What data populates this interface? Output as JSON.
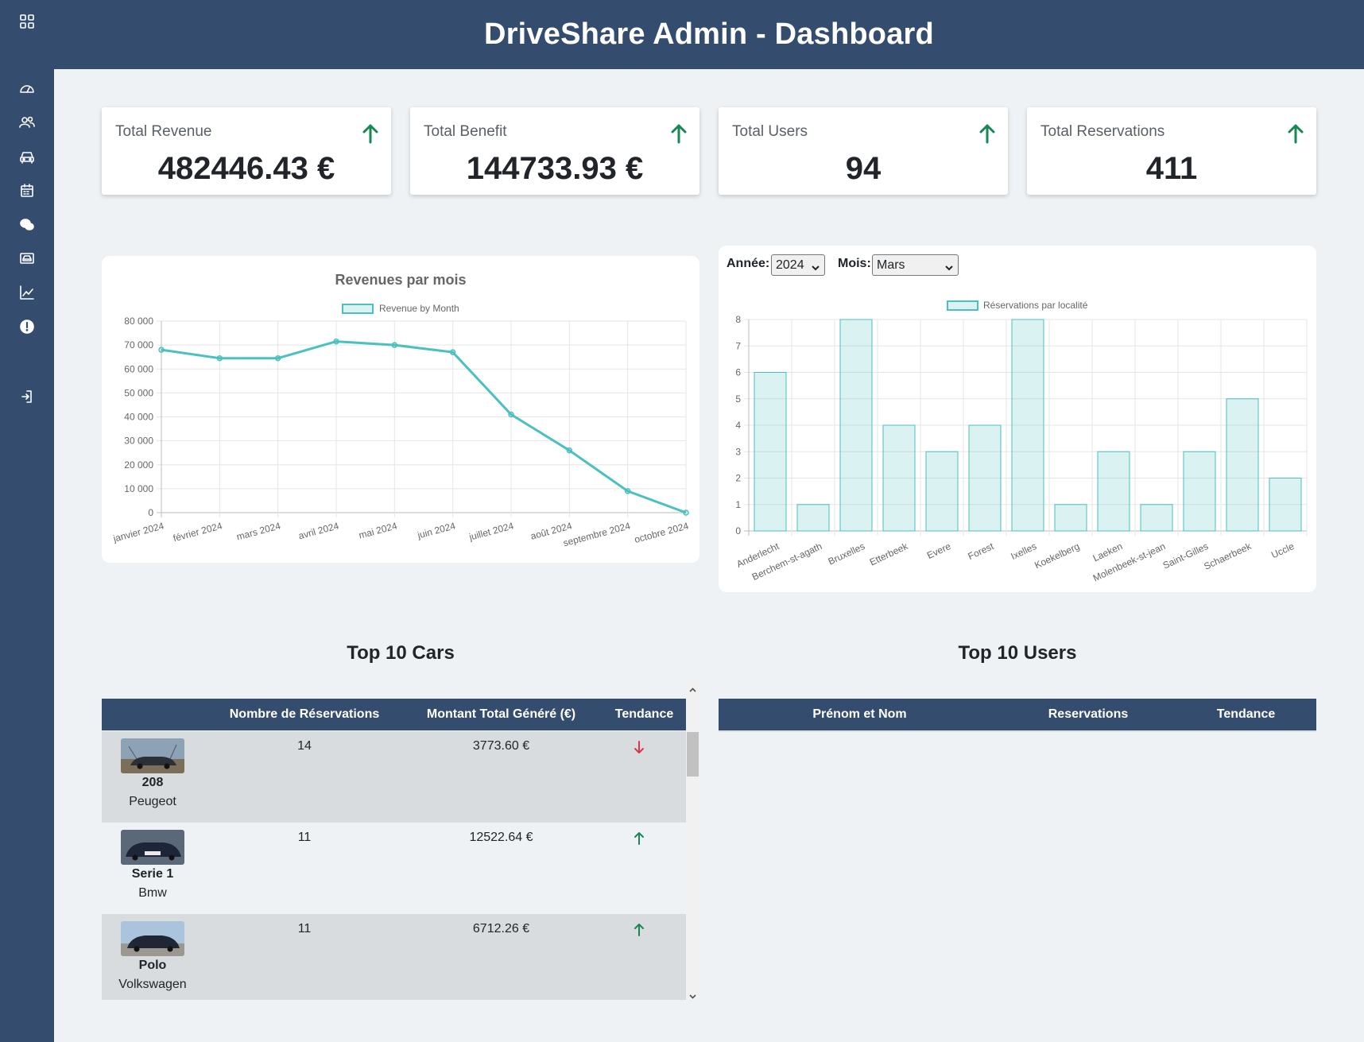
{
  "sidebar": {
    "icons": [
      "grid-icon",
      "dashboard-icon",
      "users-icon",
      "car-icon",
      "calendar-icon",
      "chat-icon",
      "vehicle-card-icon",
      "chart-icon",
      "alert-icon",
      "logout-icon"
    ]
  },
  "header": {
    "title": "DriveShare Admin - Dashboard"
  },
  "kpis": [
    {
      "label": "Total Revenue",
      "value": "482446.43 €",
      "trend": "up"
    },
    {
      "label": "Total Benefit",
      "value": "144733.93 €",
      "trend": "up"
    },
    {
      "label": "Total Users",
      "value": "94",
      "trend": "up"
    },
    {
      "label": "Total Reservations",
      "value": "411",
      "trend": "up"
    }
  ],
  "filters": {
    "year_label": "Année:",
    "year_value": "2024",
    "month_label": "Mois:",
    "month_value": "Mars"
  },
  "colors": {
    "primary": "#344c6e",
    "teal": "#4bc0c0",
    "green": "#198754",
    "red": "#dc3545",
    "background": "#eef2f5"
  },
  "chart_data": [
    {
      "type": "line",
      "title": "Revenues par mois",
      "legend": "Revenue by Month",
      "categories": [
        "janvier 2024",
        "février 2024",
        "mars 2024",
        "avril 2024",
        "mai 2024",
        "juin 2024",
        "juillet 2024",
        "août 2024",
        "septembre 2024",
        "octobre 2024"
      ],
      "values": [
        68000,
        64500,
        64500,
        71500,
        70000,
        67000,
        41000,
        26000,
        9000,
        0
      ],
      "yticks": [
        "0",
        "10 000",
        "20 000",
        "30 000",
        "40 000",
        "50 000",
        "60 000",
        "70 000",
        "80 000"
      ],
      "ylim": [
        0,
        80000
      ],
      "grid": true,
      "legend_position": "top"
    },
    {
      "type": "bar",
      "title": "",
      "legend": "Réservations par localité",
      "categories": [
        "Anderlecht",
        "Berchem-st-agath",
        "Bruxelles",
        "Etterbeek",
        "Evere",
        "Forest",
        "Ixelles",
        "Koekelberg",
        "Laeken",
        "Molenbeek-st-jean",
        "Saint-Gilles",
        "Schaerbeek",
        "Uccle"
      ],
      "values": [
        6,
        1,
        8,
        4,
        3,
        4,
        8,
        1,
        3,
        1,
        3,
        5,
        2
      ],
      "yticks": [
        "0",
        "1",
        "2",
        "3",
        "4",
        "5",
        "6",
        "7",
        "8"
      ],
      "ylim": [
        0,
        8
      ],
      "grid": true,
      "legend_position": "top"
    }
  ],
  "top_cars": {
    "title": "Top 10 Cars",
    "headers": [
      "",
      "Nombre de Réservations",
      "Montant Total Généré (€)",
      "Tendance"
    ],
    "rows": [
      {
        "model": "208",
        "brand": "Peugeot",
        "reservations": "14",
        "amount": "3773.60 €",
        "trend": "down"
      },
      {
        "model": "Serie 1",
        "brand": "Bmw",
        "reservations": "11",
        "amount": "12522.64 €",
        "trend": "up"
      },
      {
        "model": "Polo",
        "brand": "Volkswagen",
        "reservations": "11",
        "amount": "6712.26 €",
        "trend": "up"
      }
    ]
  },
  "top_users": {
    "title": "Top 10 Users",
    "headers": [
      "Prénom et Nom",
      "Reservations",
      "Tendance"
    ]
  }
}
